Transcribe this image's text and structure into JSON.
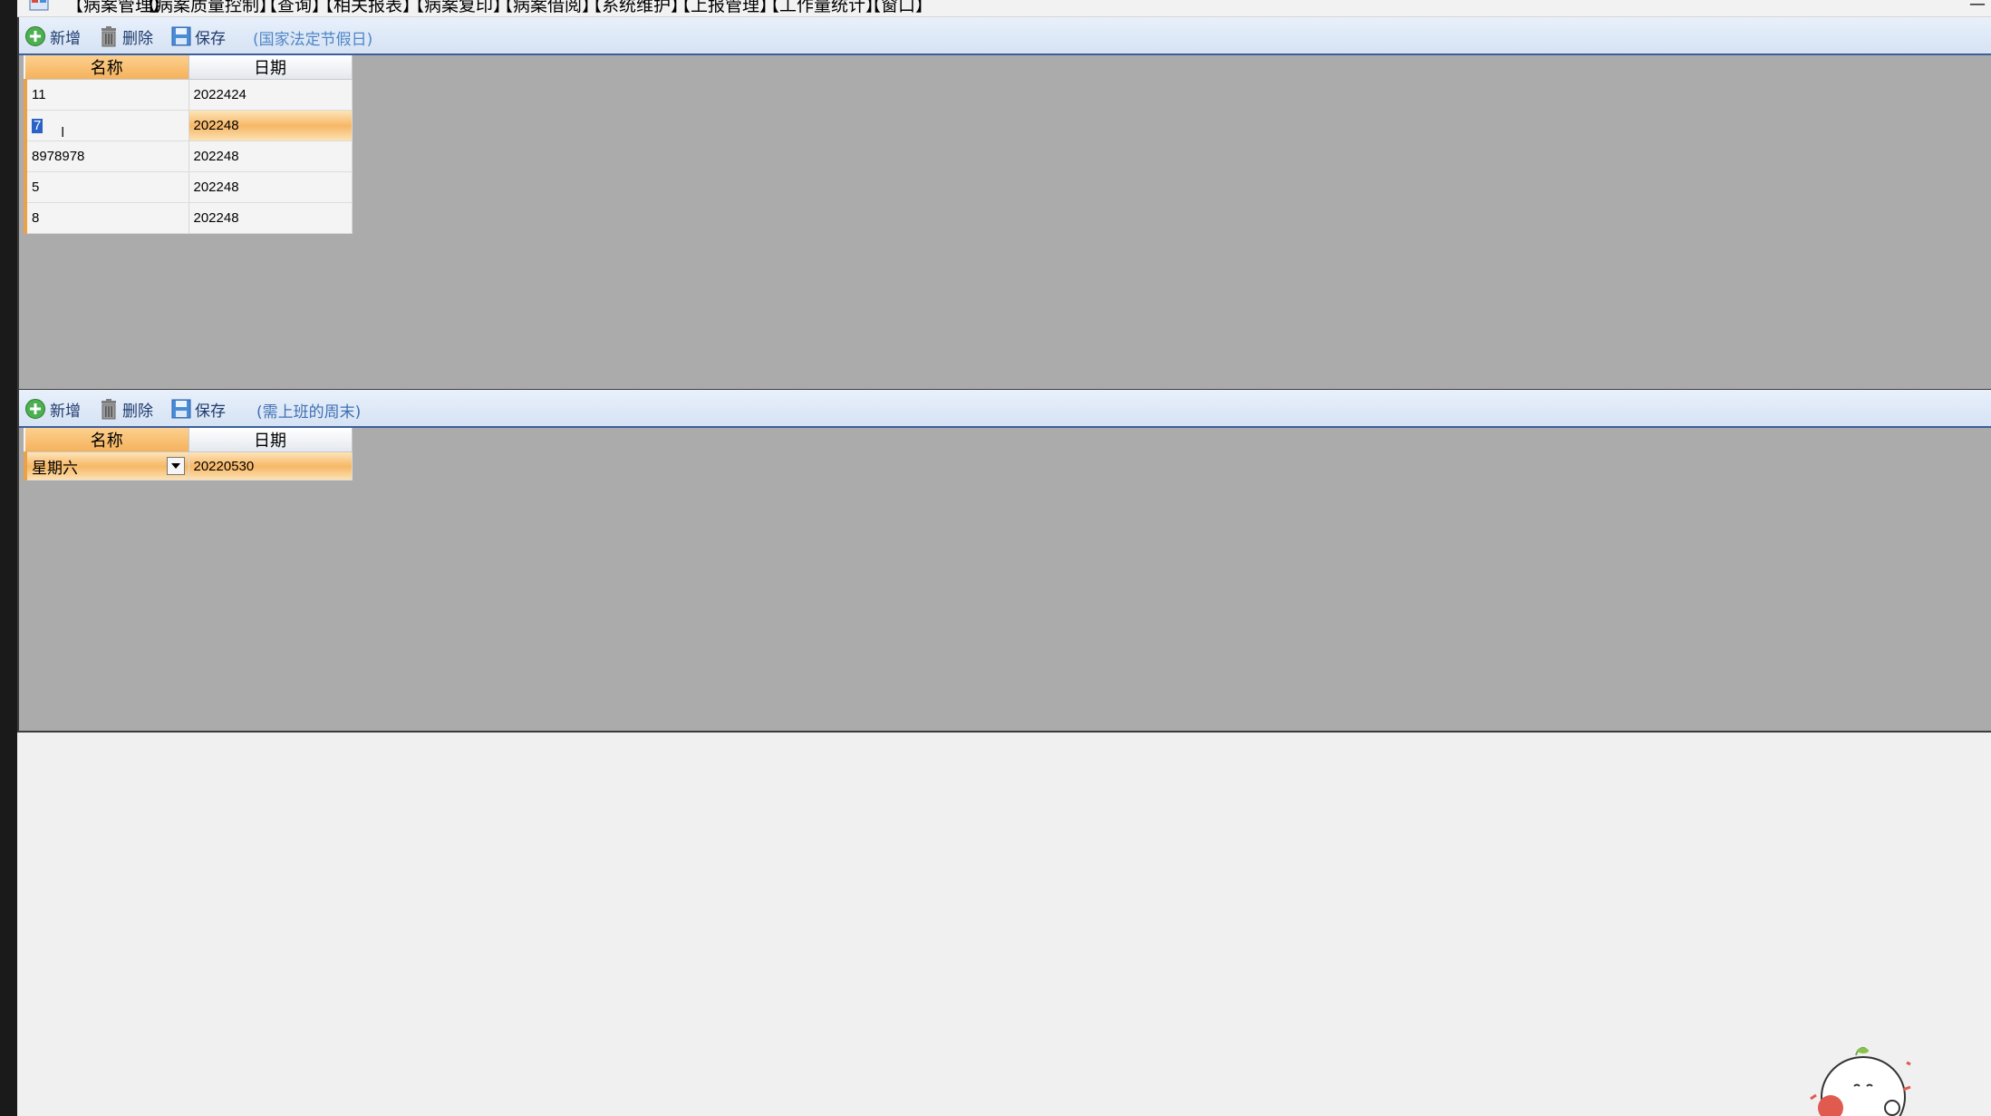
{
  "menubar": {
    "items": [
      "【病案管理】",
      "【病案质量控制】",
      "【查询】",
      "【相关报表】",
      "【病案复印】",
      "【病案借阅】",
      "【系统维护】",
      "【上报管理】",
      "【工作量统计】",
      "【窗口】"
    ],
    "minimize": "—"
  },
  "holidays_panel": {
    "toolbar": {
      "add_label": "新增",
      "delete_label": "删除",
      "save_label": "保存",
      "caption": "(国家法定节假日)"
    },
    "columns": [
      "名称",
      "日期"
    ],
    "rows": [
      {
        "name": "11",
        "date": "2022424"
      },
      {
        "name": "7",
        "date": "202248"
      },
      {
        "name": "8978978",
        "date": "202248"
      },
      {
        "name": "5",
        "date": "202248"
      },
      {
        "name": "8",
        "date": "202248"
      }
    ],
    "selected_row": 1
  },
  "workdays_panel": {
    "toolbar": {
      "add_label": "新增",
      "delete_label": "删除",
      "save_label": "保存",
      "caption": "(需上班的周末)"
    },
    "columns": [
      "名称",
      "日期"
    ],
    "rows": [
      {
        "name": "星期六",
        "date": "20220530"
      }
    ]
  },
  "colors": {
    "accent_orange": "#f5b25c",
    "toolbar_blue": "#d6e3f4",
    "panel_gray": "#ababab",
    "caption_blue": "#4f86c6"
  },
  "icons": {
    "add": "plus-circle-icon",
    "delete": "trash-icon",
    "save": "floppy-icon"
  }
}
